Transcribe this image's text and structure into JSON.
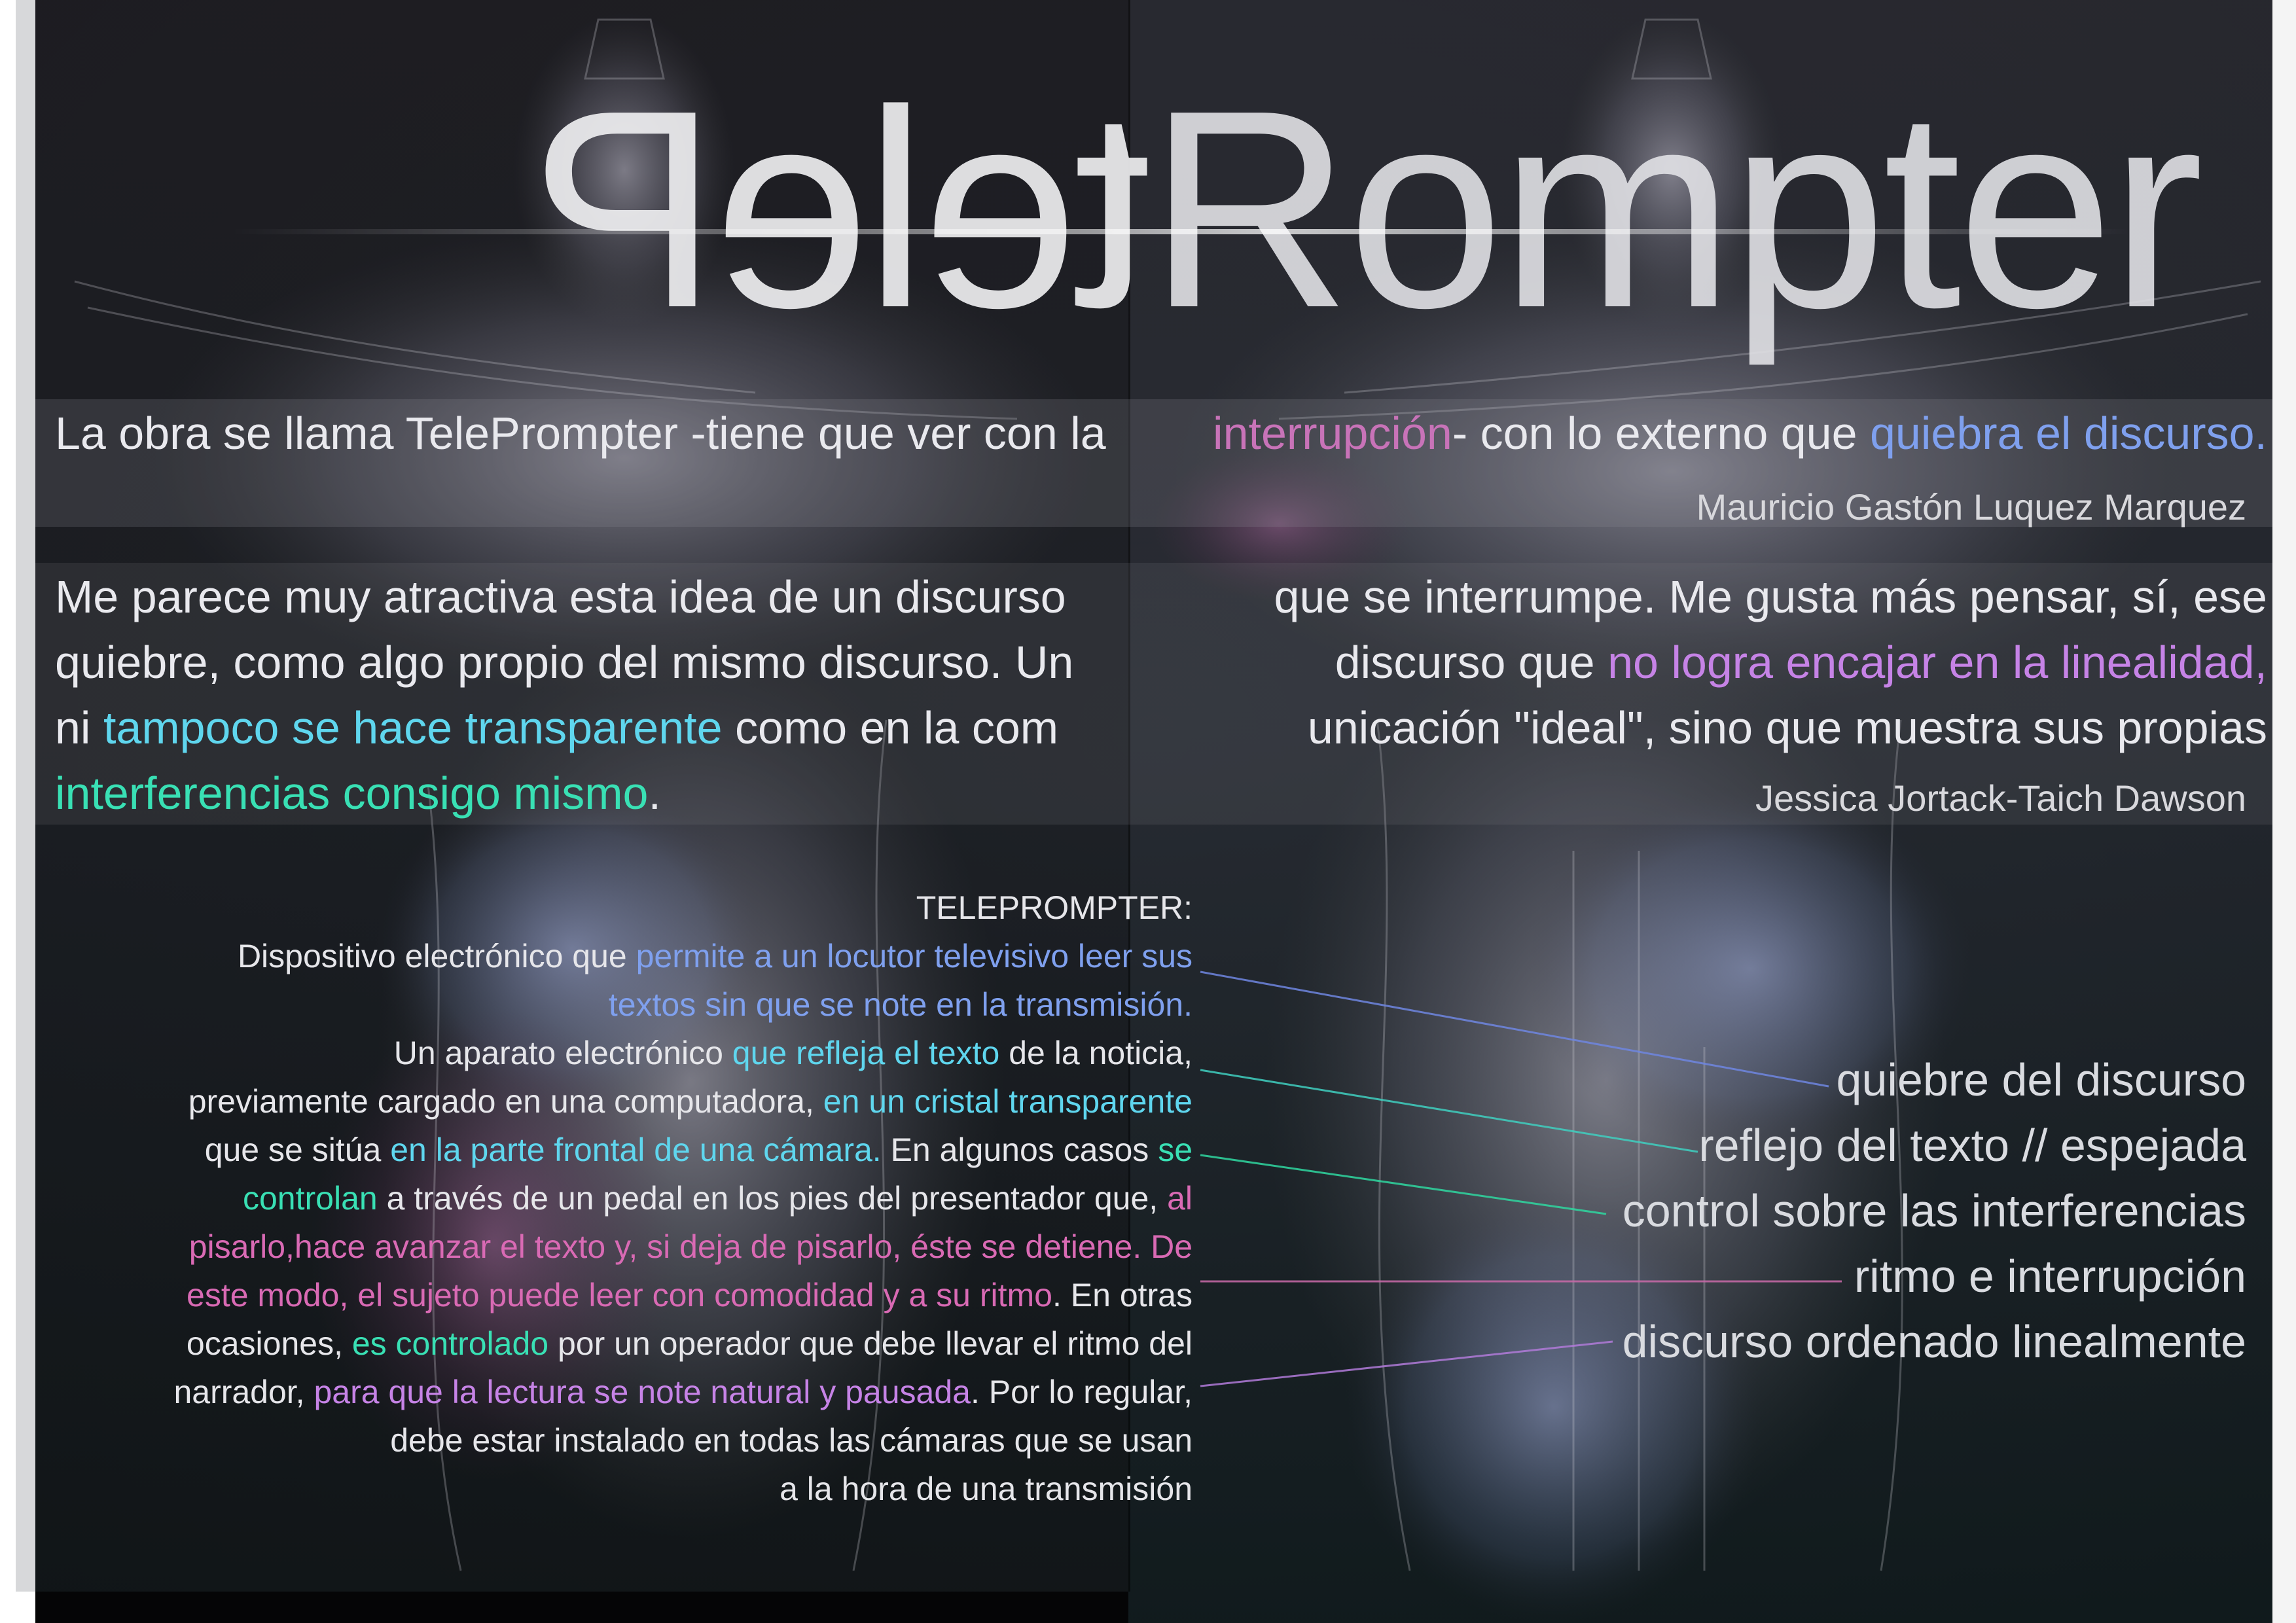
{
  "title": {
    "mirrored": "teleP",
    "normal": "Rompter"
  },
  "quote1": {
    "left_text": "La obra se llama TelePrompter -tiene que ver con la",
    "right_highlight_1": "interrupción",
    "right_text": "- con lo externo que",
    "right_highlight_2": "quiebra el discurso.",
    "author": "Mauricio Gastón Luquez Marquez"
  },
  "quote2": {
    "left_lines": [
      [
        {
          "t": "Me parece muy atractiva esta idea de un discurso",
          "c": ""
        }
      ],
      [
        {
          "t": "quiebre, como algo propio del mismo discurso. Un",
          "c": ""
        }
      ],
      [
        {
          "t": "ni ",
          "c": ""
        },
        {
          "t": "tampoco se hace transparente",
          "c": "cyan"
        },
        {
          "t": " como en la com",
          "c": ""
        }
      ],
      [
        {
          "t": "interferencias consigo mismo",
          "c": "teal"
        },
        {
          "t": ".",
          "c": ""
        }
      ]
    ],
    "right_lines": [
      [
        {
          "t": "que se interrumpe. Me gusta más pensar, sí, ese",
          "c": ""
        }
      ],
      [
        {
          "t": "discurso que ",
          "c": ""
        },
        {
          "t": "no logra encajar en la linealidad,",
          "c": "violet"
        }
      ],
      [
        {
          "t": "unicación \"ideal\", sino que muestra sus propias",
          "c": ""
        }
      ]
    ],
    "author": "Jessica Jortack-Taich Dawson"
  },
  "definition": {
    "heading": "TELEPROMPTER:",
    "lines": [
      [
        {
          "t": "Dispositivo electrónico que ",
          "c": ""
        },
        {
          "t": "permite a un locutor televisivo leer sus",
          "c": "blue"
        }
      ],
      [
        {
          "t": "textos sin que se note en la transmisión.",
          "c": "blue"
        }
      ],
      [
        {
          "t": "Un aparato electrónico ",
          "c": ""
        },
        {
          "t": "que refleja el texto",
          "c": "cyan"
        },
        {
          "t": " de la noticia,",
          "c": ""
        }
      ],
      [
        {
          "t": "previamente cargado en una computadora, ",
          "c": ""
        },
        {
          "t": "en un cristal transparente",
          "c": "cyan"
        }
      ],
      [
        {
          "t": "que se sitúa ",
          "c": ""
        },
        {
          "t": "en la parte frontal de una cámara.",
          "c": "cyan"
        },
        {
          "t": " En algunos casos ",
          "c": ""
        },
        {
          "t": "se",
          "c": "teal"
        }
      ],
      [
        {
          "t": "controlan",
          "c": "teal"
        },
        {
          "t": " a través de un pedal en los pies del presentador que, ",
          "c": ""
        },
        {
          "t": "al",
          "c": "pink"
        }
      ],
      [
        {
          "t": "pisarlo,hace avanzar el texto y, si deja de pisarlo, éste se detiene. De",
          "c": "pink"
        }
      ],
      [
        {
          "t": "este modo, el sujeto puede leer con comodidad y a su ritmo",
          "c": "pink"
        },
        {
          "t": ". En otras",
          "c": ""
        }
      ],
      [
        {
          "t": "ocasiones, ",
          "c": ""
        },
        {
          "t": "es controlado",
          "c": "teal"
        },
        {
          "t": " por un operador que debe llevar el ritmo del",
          "c": ""
        }
      ],
      [
        {
          "t": "narrador, ",
          "c": ""
        },
        {
          "t": "para que la lectura se note natural y pausada",
          "c": "violet"
        },
        {
          "t": ". Por lo regular,",
          "c": ""
        }
      ],
      [
        {
          "t": "debe estar instalado en todas las cámaras que se usan",
          "c": ""
        }
      ],
      [
        {
          "t": "a la hora de una transmisión",
          "c": ""
        }
      ]
    ]
  },
  "concepts": [
    "quiebre del discurso",
    "reflejo del texto // espejada",
    "control sobre las interferencias",
    "ritmo e interrupción",
    "discurso ordenado linealmente"
  ],
  "colors": {
    "cyan": "#5fd6ee",
    "teal": "#39e0b4",
    "blue": "#7fa0ee",
    "pink": "#d96ab4",
    "violet": "#c683e6",
    "line_blue": "#6f86e0",
    "line_teal": "#3fcfc0",
    "line_green": "#2fd7a0",
    "line_pink": "#c86aa8",
    "line_violet": "#b07ad8"
  }
}
